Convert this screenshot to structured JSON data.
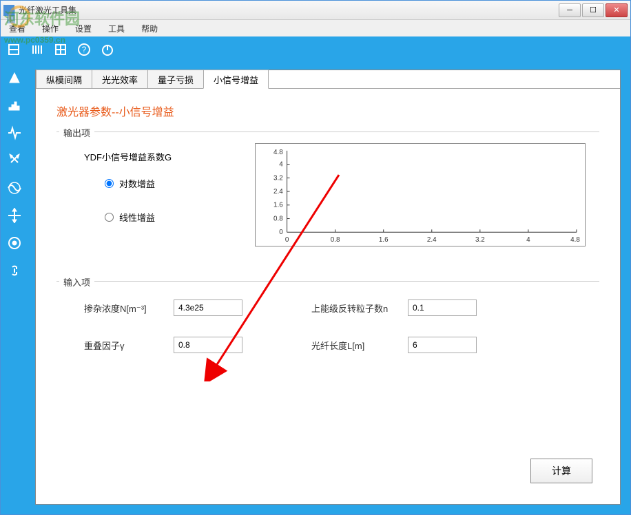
{
  "titlebar": {
    "title": "光纤激光工具集"
  },
  "watermark": {
    "text": "河东软件园",
    "url": "www.pc0359.cn"
  },
  "menubar": {
    "items": [
      "查看",
      "操作",
      "设置",
      "工具",
      "帮助"
    ]
  },
  "tabs": {
    "items": [
      "纵模间隔",
      "光光效率",
      "量子亏损",
      "小信号增益"
    ],
    "active_index": 3
  },
  "page": {
    "title": "激光器参数--小信号增益"
  },
  "output": {
    "legend": "输出项",
    "group_title": "YDF小信号增益系数G",
    "radio_log": "对数增益",
    "radio_linear": "线性增益"
  },
  "input": {
    "legend": "输入项",
    "doping_label": "掺杂浓度N[m⁻³]",
    "doping_value": "4.3e25",
    "inversion_label": "上能级反转粒子数n",
    "inversion_value": "0.1",
    "overlap_label": "重叠因子γ",
    "overlap_value": "0.8",
    "length_label": "光纤长度L[m]",
    "length_value": "6"
  },
  "button": {
    "calculate": "计算"
  },
  "chart_data": {
    "type": "line",
    "xlim": [
      0,
      4.8
    ],
    "ylim": [
      0,
      4.8
    ],
    "xticks": [
      0,
      0.8,
      1.6,
      2.4,
      3.2,
      4.0,
      4.8
    ],
    "yticks": [
      0,
      0.8,
      1.6,
      2.4,
      3.2,
      4.0,
      4.8
    ],
    "series": []
  }
}
